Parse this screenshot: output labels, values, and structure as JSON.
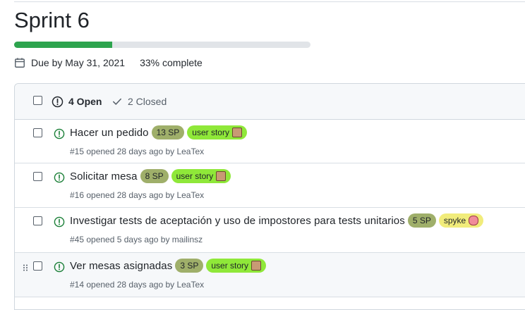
{
  "milestone": {
    "title": "Sprint 6",
    "progress_percent": 33,
    "due": "Due by May 31, 2021",
    "complete": "33% complete",
    "icons": {
      "calendar": "calendar-icon"
    }
  },
  "header": {
    "open": "4 Open",
    "closed": "2 Closed"
  },
  "colors": {
    "progress": "#2da44e",
    "open_icon": "#1a7f37",
    "sp_label": "#9faf6a",
    "user_story": "#8fe839",
    "spyke": "#f1ec7b"
  },
  "issues": [
    {
      "title": "Hacer un pedido",
      "sp": "13 SP",
      "tag": "user story",
      "meta": "#15 opened 28 days ago by LeaTex"
    },
    {
      "title": "Solicitar mesa",
      "sp": "8 SP",
      "tag": "user story",
      "meta": "#16 opened 28 days ago by LeaTex"
    },
    {
      "title": "Investigar tests de aceptación y uso de impostores para tests unitarios",
      "sp": "5 SP",
      "tag": "spyke",
      "meta": "#45 opened 5 days ago by mailinsz"
    },
    {
      "title": "Ver mesas asignadas",
      "sp": "3 SP",
      "tag": "user story",
      "meta": "#14 opened 28 days ago by LeaTex"
    }
  ]
}
